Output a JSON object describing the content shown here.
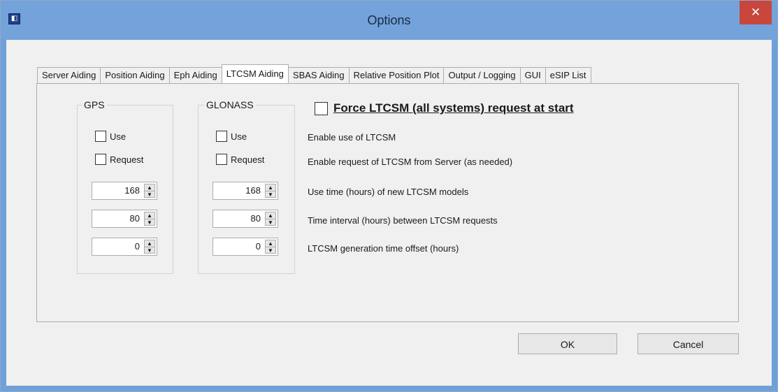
{
  "window": {
    "title": "Options",
    "close_glyph": "✕",
    "app_icon_glyph": "◧"
  },
  "tabs": [
    {
      "label": "Server Aiding"
    },
    {
      "label": "Position Aiding"
    },
    {
      "label": "Eph Aiding"
    },
    {
      "label": "LTCSM Aiding"
    },
    {
      "label": "SBAS Aiding"
    },
    {
      "label": "Relative Position Plot"
    },
    {
      "label": "Output / Logging"
    },
    {
      "label": "GUI"
    },
    {
      "label": "eSIP List"
    }
  ],
  "active_tab": "LTCSM Aiding",
  "gps": {
    "title": "GPS",
    "use_label": "Use",
    "request_label": "Request",
    "spins": [
      {
        "value": "168"
      },
      {
        "value": "80"
      },
      {
        "value": "0"
      }
    ]
  },
  "glonass": {
    "title": "GLONASS",
    "use_label": "Use",
    "request_label": "Request",
    "spins": [
      {
        "value": "168"
      },
      {
        "value": "80"
      },
      {
        "value": "0"
      }
    ]
  },
  "force": {
    "label": "Force LTCSM (all systems) request at start",
    "checked": false
  },
  "descriptions": {
    "use": "Enable use of LTCSM",
    "request": "Enable request of LTCSM from Server (as needed)",
    "use_time": "Use time (hours) of new LTCSM models",
    "interval": "Time interval (hours) between LTCSM requests",
    "offset": "LTCSM generation time offset (hours)"
  },
  "buttons": {
    "ok": "OK",
    "cancel": "Cancel"
  }
}
